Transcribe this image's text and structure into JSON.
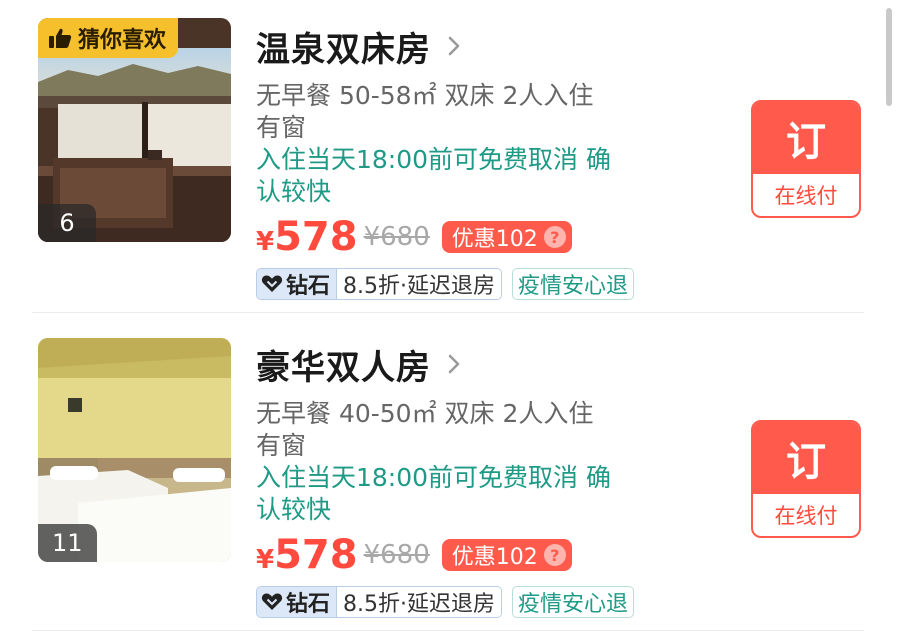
{
  "rooms": [
    {
      "tag": "猜你喜欢",
      "photo_count": "6",
      "title": "温泉双床房",
      "spec_line1": "无早餐 50-58㎡ 双床 2人入住",
      "spec_line2": "有窗",
      "cancel_line1": "入住当天18:00前可免费取消 确",
      "cancel_line2": "认较快",
      "currency": "¥",
      "price": "578",
      "original_price": "¥680",
      "discount": "优惠102",
      "discount_help": "?",
      "member_tag": "钻石",
      "member_benefit": "8.5折·延迟退房",
      "policy_tag": "疫情安心退",
      "book_label": "订",
      "pay_label": "在线付"
    },
    {
      "photo_count": "11",
      "title": "豪华双人房",
      "spec_line1": "无早餐 40-50㎡ 双床 2人入住",
      "spec_line2": "有窗",
      "cancel_line1": "入住当天18:00前可免费取消 确",
      "cancel_line2": "认较快",
      "currency": "¥",
      "price": "578",
      "original_price": "¥680",
      "discount": "优惠102",
      "discount_help": "?",
      "member_tag": "钻石",
      "member_benefit": "8.5折·延迟退房",
      "policy_tag": "疫情安心退",
      "book_label": "订",
      "pay_label": "在线付"
    }
  ],
  "colors": {
    "accent_red": "#ff5a4c",
    "price_red": "#ff4a3d",
    "teal": "#1e9a86",
    "tag_yellow": "#f5c02b",
    "diamond_blue": "#dce8f7"
  },
  "icons": [
    "thumbs-up-icon",
    "chevron-right-icon",
    "diamond-heart-icon",
    "help-icon"
  ]
}
